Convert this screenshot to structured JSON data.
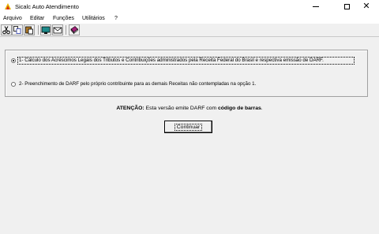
{
  "window": {
    "title": "Sicalc Auto Atendimento",
    "controls": {
      "minimize": "minimize",
      "maximize": "maximize",
      "close": "✕"
    }
  },
  "menu": [
    "Arquivo",
    "Editar",
    "Funções",
    "Utilitários",
    "?"
  ],
  "toolbar": {
    "icons": [
      "scissors-icon",
      "copy-icon",
      "paste-icon",
      "monitor-icon",
      "mail-icon",
      "book-icon"
    ]
  },
  "options": {
    "option1": "1- Cálculo dos Acréscimos Legais dos Tributos e Contribuições administrados pela Receita Federal do Brasil  e respectiva emissão de DARF.",
    "option2": "2- Preenchimento de DARF pelo próprio contribuinte para as demais Receitas não contempladas na opção 1.",
    "selected": 1
  },
  "notice": {
    "label": "ATENÇÃO:",
    "text": " Esta versão emite DARF com ",
    "bold_text": "código de barras",
    "end": "."
  },
  "buttons": {
    "continue": "Continuar"
  }
}
